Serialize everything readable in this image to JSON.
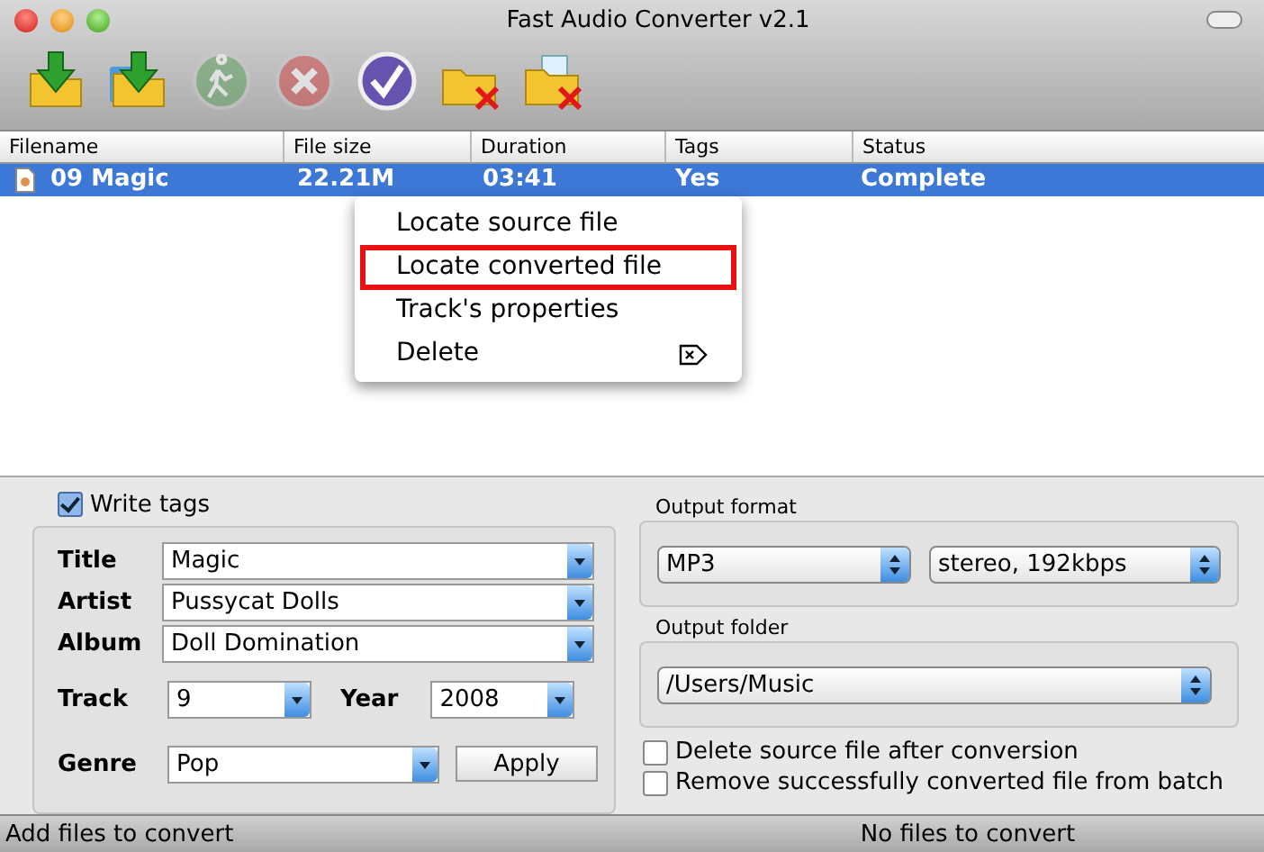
{
  "window": {
    "title": "Fast Audio Converter v2.1"
  },
  "toolbar": [
    {
      "kind": "add-file",
      "disabled": false
    },
    {
      "kind": "add-folder",
      "disabled": false
    },
    {
      "kind": "start",
      "disabled": true
    },
    {
      "kind": "stop",
      "disabled": true
    },
    {
      "kind": "check",
      "disabled": false
    },
    {
      "kind": "remove",
      "disabled": false
    },
    {
      "kind": "clear",
      "disabled": false
    }
  ],
  "table": {
    "columns": [
      "Filename",
      "File size",
      "Duration",
      "Tags",
      "Status"
    ],
    "rows": [
      {
        "selected": true,
        "cells": [
          "09 Magic",
          "22.21M",
          "03:41",
          "Yes",
          "Complete"
        ]
      }
    ]
  },
  "context_menu": {
    "items": [
      {
        "label": "Locate source file",
        "highlighted": false
      },
      {
        "label": "Locate converted file",
        "highlighted": true
      },
      {
        "label": "Track's properties",
        "highlighted": false
      },
      {
        "label": "Delete",
        "highlighted": false,
        "shortcut_icon": true
      }
    ]
  },
  "tags": {
    "write_tags": {
      "label": "Write tags",
      "checked": true
    },
    "title": {
      "label": "Title",
      "value": "Magic"
    },
    "artist": {
      "label": "Artist",
      "value": "Pussycat Dolls"
    },
    "album": {
      "label": "Album",
      "value": "Doll Domination"
    },
    "track": {
      "label": "Track",
      "value": "9"
    },
    "year": {
      "label": "Year",
      "value": "2008"
    },
    "genre": {
      "label": "Genre",
      "value": "Pop"
    },
    "apply": "Apply"
  },
  "output_format": {
    "label": "Output format",
    "format": "MP3",
    "quality": "stereo, 192kbps"
  },
  "output_folder": {
    "label": "Output folder",
    "path": "/Users/Music"
  },
  "options": [
    {
      "label": "Delete source file after conversion",
      "checked": false
    },
    {
      "label": "Remove successfully converted file from batch",
      "checked": false
    }
  ],
  "status_bar": {
    "left": "Add files to convert",
    "right": "No files to convert"
  }
}
